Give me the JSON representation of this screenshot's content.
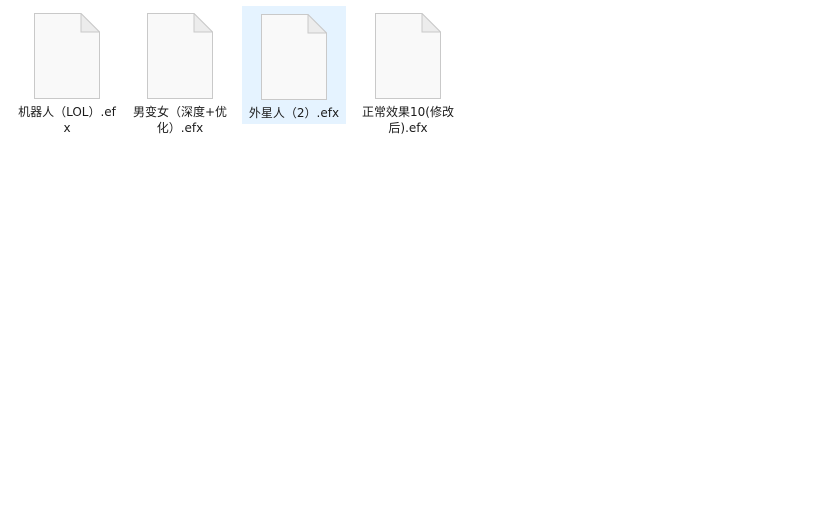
{
  "files": [
    {
      "name": "机器人（LOL）.efx",
      "icon": "blank-file-icon",
      "selected": false
    },
    {
      "name": "男变女（深度+优化）.efx",
      "icon": "blank-file-icon",
      "selected": false
    },
    {
      "name": "外星人（2）.efx",
      "icon": "blank-file-icon",
      "selected": true
    },
    {
      "name": "正常效果10(修改后).efx",
      "icon": "blank-file-icon",
      "selected": false
    }
  ],
  "colors": {
    "background": "#ffffff",
    "selection": "#e5f3ff",
    "icon_body": "#f9f9f9",
    "icon_border": "#c9c9c9",
    "text": "#1b1b1b"
  }
}
